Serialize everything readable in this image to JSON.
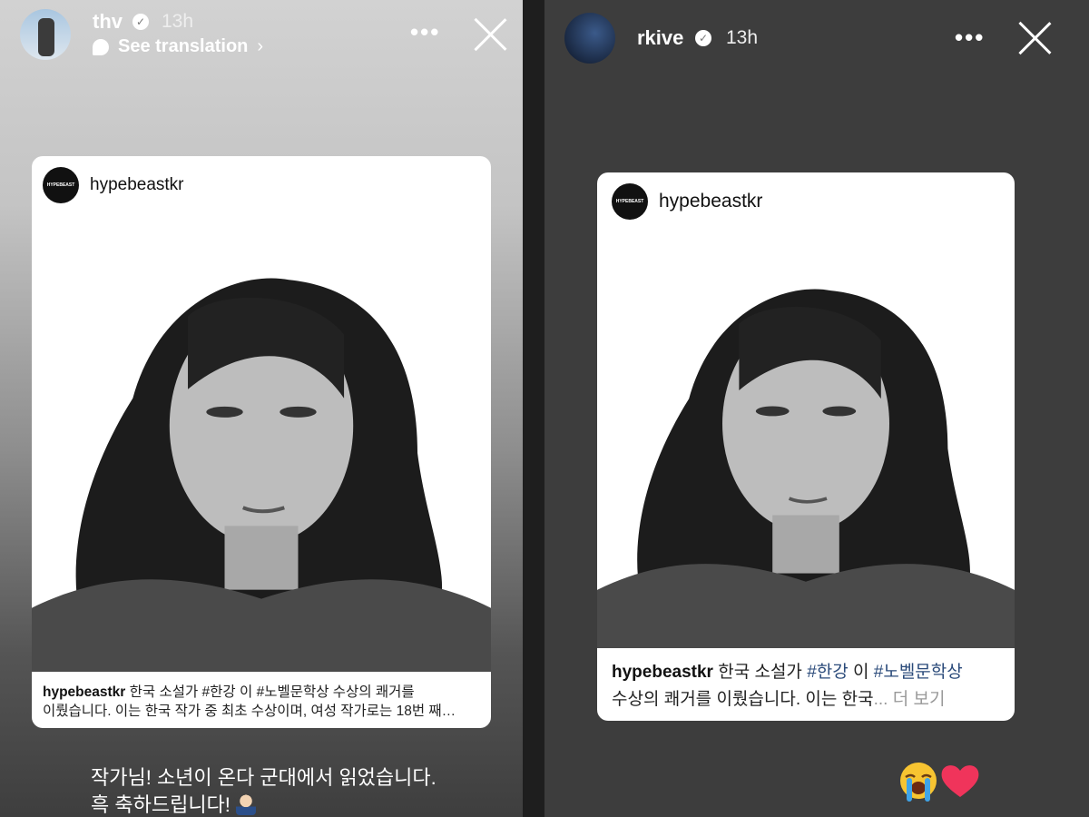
{
  "left_story": {
    "username": "thv",
    "time": "13h",
    "translate": "See translation",
    "card": {
      "account": "hypebeastkr",
      "logo_text": "HYPEBEAST",
      "caption_user": "hypebeastkr",
      "caption_line1": "한국 소설가 #한강 이 #노벨문학상 수상의 쾌거를",
      "caption_line2": "이뤘습니다. 이는 한국 작가 중 최초 수상이며, 여성 작가로는 18번 째…"
    },
    "message_line1": "작가님! 소년이 온다 군대에서 읽었습니다.",
    "message_line2": "흑 축하드립니다!"
  },
  "right_story": {
    "username": "rkive",
    "time": "13h",
    "card": {
      "account": "hypebeastkr",
      "logo_text": "HYPEBEAST",
      "caption_user": "hypebeastkr",
      "caption_text1": "한국 소설가 ",
      "caption_tag1": "#한강",
      "caption_text2": " 이 ",
      "caption_tag2": "#노벨문학상",
      "caption_line2": "수상의 쾌거를 이뤘습니다. 이는 한국",
      "more": "... 더 보기"
    }
  },
  "colors": {
    "hashtag": "#2a4a7a",
    "right_bg": "#3d3d3d"
  }
}
